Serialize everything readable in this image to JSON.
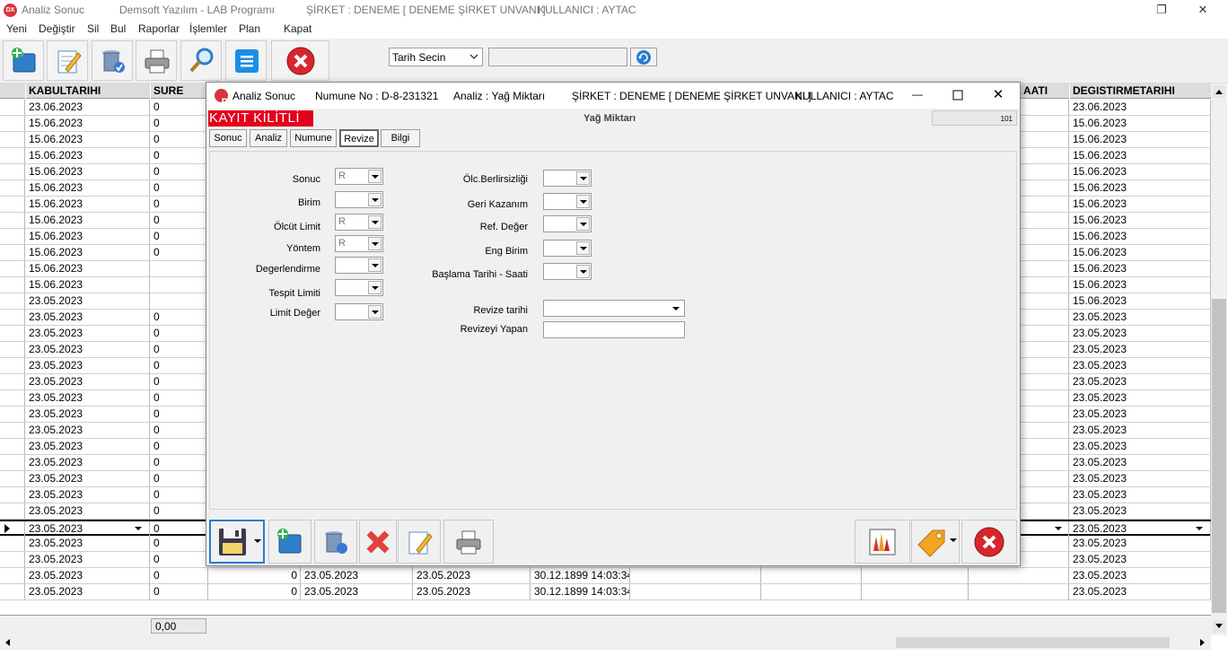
{
  "window": {
    "app_title": "Analiz Sonuc",
    "program": "Demsoft Yazılım - LAB Programı",
    "company": "ŞİRKET : DENEME [ DENEME ŞİRKET UNVANI ]",
    "user": "KULLANICI : AYTAC",
    "logo_text": "DX"
  },
  "menu": [
    "Yeni",
    "Değiştir",
    "Sil",
    "Bul",
    "Raporlar",
    "İşlemler",
    "Plan",
    "Kapat"
  ],
  "toolbar": {
    "buttons": [
      "new-icon",
      "edit-icon",
      "delete-icon",
      "print-icon",
      "search-icon",
      "list-icon",
      "close-icon"
    ],
    "date_select": "Tarih Secin",
    "date_value": ""
  },
  "grid": {
    "headers": {
      "kabul": "KABULTARIHI",
      "sure": "SURE",
      "saati": "AATI",
      "degistir": "DEGISTIRMETARIHI"
    },
    "rows": [
      {
        "kabul": "23.06.2023",
        "sure": "0",
        "degistir": "23.06.2023"
      },
      {
        "kabul": "15.06.2023",
        "sure": "0",
        "degistir": "15.06.2023"
      },
      {
        "kabul": "15.06.2023",
        "sure": "0",
        "degistir": "15.06.2023"
      },
      {
        "kabul": "15.06.2023",
        "sure": "0",
        "degistir": "15.06.2023"
      },
      {
        "kabul": "15.06.2023",
        "sure": "0",
        "degistir": "15.06.2023"
      },
      {
        "kabul": "15.06.2023",
        "sure": "0",
        "degistir": "15.06.2023"
      },
      {
        "kabul": "15.06.2023",
        "sure": "0",
        "degistir": "15.06.2023"
      },
      {
        "kabul": "15.06.2023",
        "sure": "0",
        "degistir": "15.06.2023"
      },
      {
        "kabul": "15.06.2023",
        "sure": "0",
        "degistir": "15.06.2023"
      },
      {
        "kabul": "15.06.2023",
        "sure": "0",
        "degistir": "15.06.2023"
      },
      {
        "kabul": "15.06.2023",
        "sure": "",
        "degistir": "15.06.2023"
      },
      {
        "kabul": "15.06.2023",
        "sure": "",
        "degistir": "15.06.2023"
      },
      {
        "kabul": "23.05.2023",
        "sure": "",
        "degistir": "15.06.2023"
      },
      {
        "kabul": "23.05.2023",
        "sure": "0",
        "degistir": "23.05.2023"
      },
      {
        "kabul": "23.05.2023",
        "sure": "0",
        "degistir": "23.05.2023"
      },
      {
        "kabul": "23.05.2023",
        "sure": "0",
        "degistir": "23.05.2023"
      },
      {
        "kabul": "23.05.2023",
        "sure": "0",
        "degistir": "23.05.2023"
      },
      {
        "kabul": "23.05.2023",
        "sure": "0",
        "degistir": "23.05.2023"
      },
      {
        "kabul": "23.05.2023",
        "sure": "0",
        "degistir": "23.05.2023"
      },
      {
        "kabul": "23.05.2023",
        "sure": "0",
        "degistir": "23.05.2023"
      },
      {
        "kabul": "23.05.2023",
        "sure": "0",
        "degistir": "23.05.2023"
      },
      {
        "kabul": "23.05.2023",
        "sure": "0",
        "degistir": "23.05.2023"
      },
      {
        "kabul": "23.05.2023",
        "sure": "0",
        "degistir": "23.05.2023"
      },
      {
        "kabul": "23.05.2023",
        "sure": "0",
        "degistir": "23.05.2023"
      },
      {
        "kabul": "23.05.2023",
        "sure": "0",
        "degistir": "23.05.2023"
      },
      {
        "kabul": "23.05.2023",
        "sure": "0",
        "degistir": "23.05.2023"
      },
      {
        "kabul": "23.05.2023",
        "sure": "0",
        "degistir": "23.05.2023"
      },
      {
        "kabul": "23.05.2023",
        "sure": "0",
        "degistir": "23.05.2023"
      },
      {
        "kabul": "23.05.2023",
        "sure": "0",
        "degistir": "23.05.2023"
      },
      {
        "kabul": "23.05.2023",
        "sure": "0",
        "num": "0",
        "d1": "23.05.2023",
        "d2": "23.05.2023",
        "d3": "30.12.1899 14:03:34",
        "degistir": "23.05.2023"
      },
      {
        "kabul": "23.05.2023",
        "sure": "0",
        "num": "0",
        "d1": "23.05.2023",
        "d2": "23.05.2023",
        "d3": "30.12.1899 14:03:34",
        "degistir": "23.05.2023"
      }
    ],
    "footer_total": "0,00"
  },
  "modal": {
    "title": "Analiz Sonuc",
    "sample_no": "Numune No : D-8-231321",
    "analysis": "Analiz : Yağ Miktarı",
    "company": "ŞİRKET : DENEME [ DENEME ŞİRKET UNVANI ]",
    "user": "KULLANICI : AYTAC",
    "locked_banner": "KAYIT KİLİTLİ",
    "header_label": "Yağ Miktarı",
    "record_no": "101",
    "tabs": [
      "Sonuc",
      "Analiz",
      "Numune",
      "Revize",
      "Bilgi"
    ],
    "active_tab": "Revize",
    "left_fields": [
      {
        "label": "Sonuc",
        "value": "R"
      },
      {
        "label": "Birim",
        "value": ""
      },
      {
        "label": "Ölcüt Limit",
        "value": "R"
      },
      {
        "label": "Yöntem",
        "value": "R"
      },
      {
        "label": "Degerlendirme",
        "value": ""
      },
      {
        "label": "Tespit Limiti",
        "value": ""
      },
      {
        "label": "Limit Değer",
        "value": ""
      }
    ],
    "right_fields": [
      {
        "label": "Ölc.Berlirsizliği",
        "value": ""
      },
      {
        "label": "Geri Kazanım",
        "value": ""
      },
      {
        "label": "Ref. Değer",
        "value": ""
      },
      {
        "label": "Eng Birim",
        "value": ""
      },
      {
        "label": "Başlama Tarihi - Saati",
        "value": ""
      }
    ],
    "revize_date_label": "Revize tarihi",
    "revize_date_value": "",
    "revize_by_label": "Revizeyi Yapan",
    "revize_by_value": ""
  }
}
